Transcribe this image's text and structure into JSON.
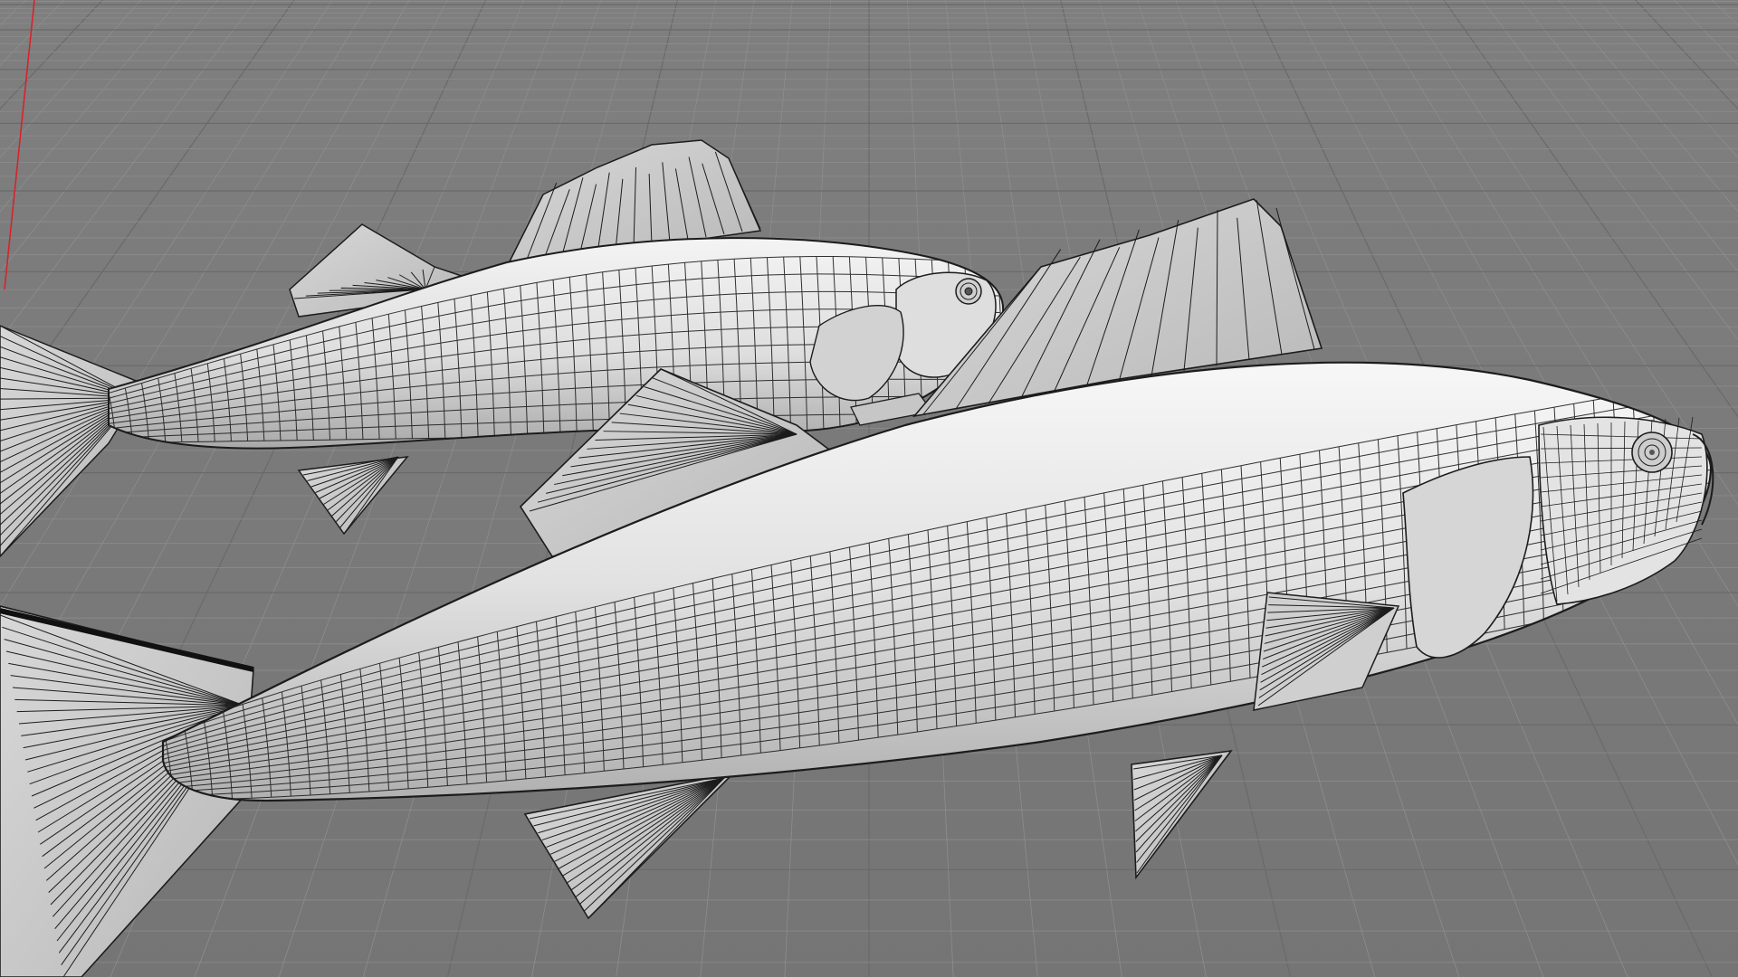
{
  "viewport": {
    "name": "perspective-viewport",
    "colors": {
      "background": "#7a7a7a",
      "grid_minor": "#8d8d8d",
      "grid_major": "#6a6a6a",
      "axis": "#d4252a",
      "fish_fill": "#dcdcdc",
      "fish_light": "#f2f2f2",
      "wire": "#1c1c1c"
    }
  },
  "models": [
    {
      "name": "fish-model-back",
      "display_mode": "shaded-wireframe"
    },
    {
      "name": "fish-model-front",
      "display_mode": "shaded-wireframe"
    }
  ]
}
